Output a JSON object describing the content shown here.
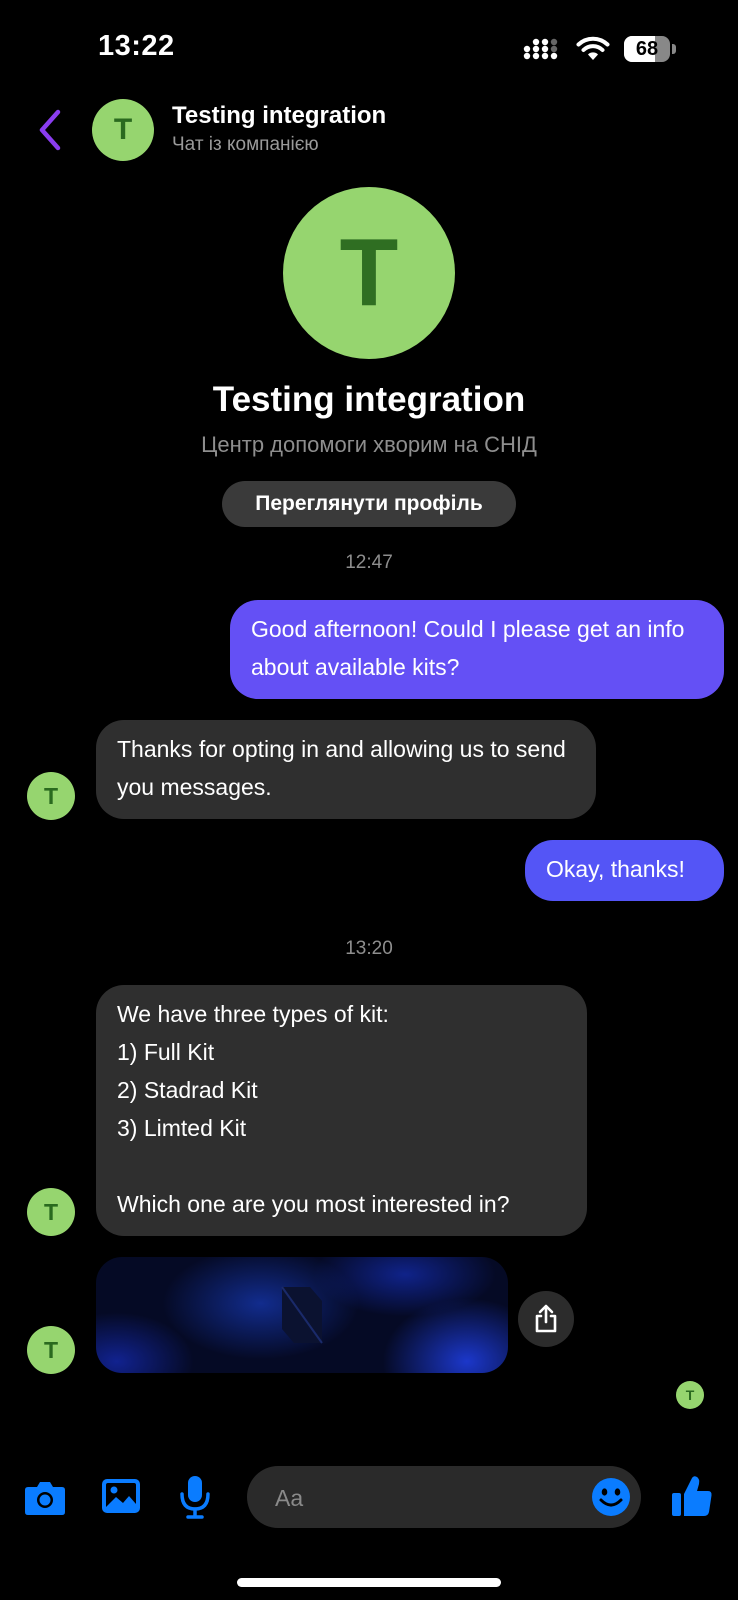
{
  "status_bar": {
    "time": "13:22",
    "battery": "68",
    "battery_level": 0.68
  },
  "header": {
    "avatar_letter": "T",
    "name": "Testing integration",
    "subtitle": "Чат із компанією"
  },
  "profile": {
    "avatar_letter": "T",
    "name": "Testing integration",
    "subtitle": "Центр допомоги хворим на СНІД",
    "view_profile_label": "Переглянути профіль"
  },
  "messages": {
    "timestamp_1": "12:47",
    "msg_1": "Good afternoon! Could I please get an info about available kits?",
    "msg_2": "Thanks for opting in and allowing us to send you messages.",
    "msg_3": "Okay, thanks!",
    "timestamp_2": "13:20",
    "msg_4": "We have three types of kit:\n1) Full Kit\n2) Stadrad Kit\n3) Limted Kit\n\nWhich one are you most interested in?",
    "avatar_letter": "T"
  },
  "composer": {
    "placeholder": "Aa"
  },
  "colors": {
    "accent": "#0a7cff",
    "outgoing": "#6450f5",
    "incoming": "#2f2f2f",
    "avatar": "#96d56f"
  }
}
